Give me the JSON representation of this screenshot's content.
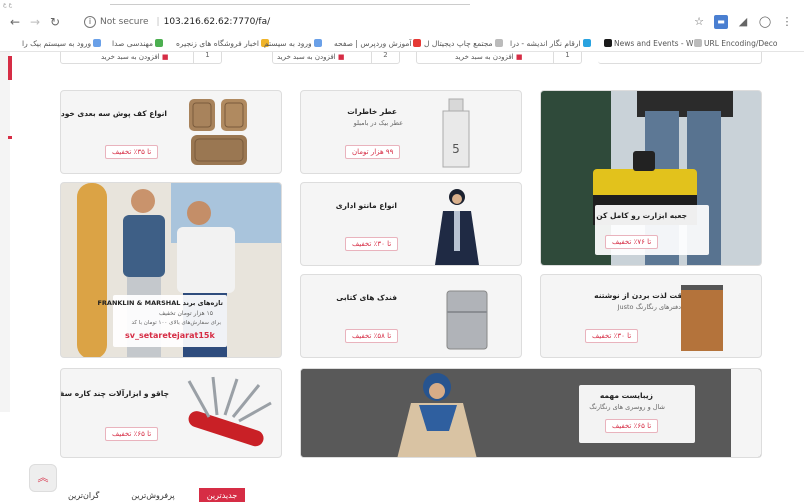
{
  "browser": {
    "top_tiny": "ع ع",
    "not_secure": "Not secure",
    "url": "103.216.62.62:7770/fa/",
    "bookmarks": [
      "ورود به سیستم بیک را",
      "مهندسی صدا",
      "اخبار فروشگاه های زنجیره",
      "ورود به سیستم",
      "آموزش وردپرس | صفحه",
      "مجتمع چاپ دیجیتال ل",
      "ارقام نگار اندیشه - درا",
      "News and Events - W",
      "URL Encoding/Deco"
    ]
  },
  "partial_cards": [
    {
      "buy_label": "افزودن به سبد خرید",
      "qty": "1"
    },
    {
      "buy_label": "افزودن به سبد خرید",
      "qty": "2"
    },
    {
      "buy_label": "افزودن به سبد خرید",
      "qty": "1"
    }
  ],
  "cards": {
    "carmat": {
      "title": "انواع کف پوش سه بعدی خودرو",
      "discount": "تا ۳۵٪ تخفیف"
    },
    "perfume": {
      "title": "عطر خاطرات",
      "subtitle": "عطر بیک در بامبلو",
      "discount": "۹۹ هزار تومان"
    },
    "toolbox": {
      "title": "جعبه ابزارت رو کامل کن",
      "discount": "تا ۷۶٪ تخفیف"
    },
    "fashion": {
      "title": "تازه‌های برند FRANKLIN & MARSHAL",
      "line1": "۱۵ هزار تومان تخفیف",
      "line2": "برای سفارش‌های بالای ۱۰۰ تومان با کد",
      "code": "sv_setaretejarat15k"
    },
    "manteau": {
      "title": "انواع مانتو اداری",
      "discount": "تا ۳۰٪ تخفیف"
    },
    "lighter": {
      "title": "فندک های کتابی",
      "discount": "تا ۵۸٪ تخفیف"
    },
    "notebook": {
      "title": "وقت لذت بردن از نوشتنه",
      "subtitle": "دفترهای رنگارنگ Justo",
      "discount": "تا ۳۰٪ تخفیف"
    },
    "knife": {
      "title": "چاقو و ابزارآلات چند کاره سفری",
      "discount": "تا ۶۵٪ تخفیف"
    },
    "scarf": {
      "title": "زیبایست مهمه",
      "subtitle": "شال و روسری های رنگارنگ",
      "discount": "تا ۶۵٪ تخفیف"
    }
  },
  "tabs": [
    "جدیدترین",
    "پرفروش‌ترین",
    "گران‌ترین"
  ],
  "colors": {
    "brand": "#d62d45"
  }
}
